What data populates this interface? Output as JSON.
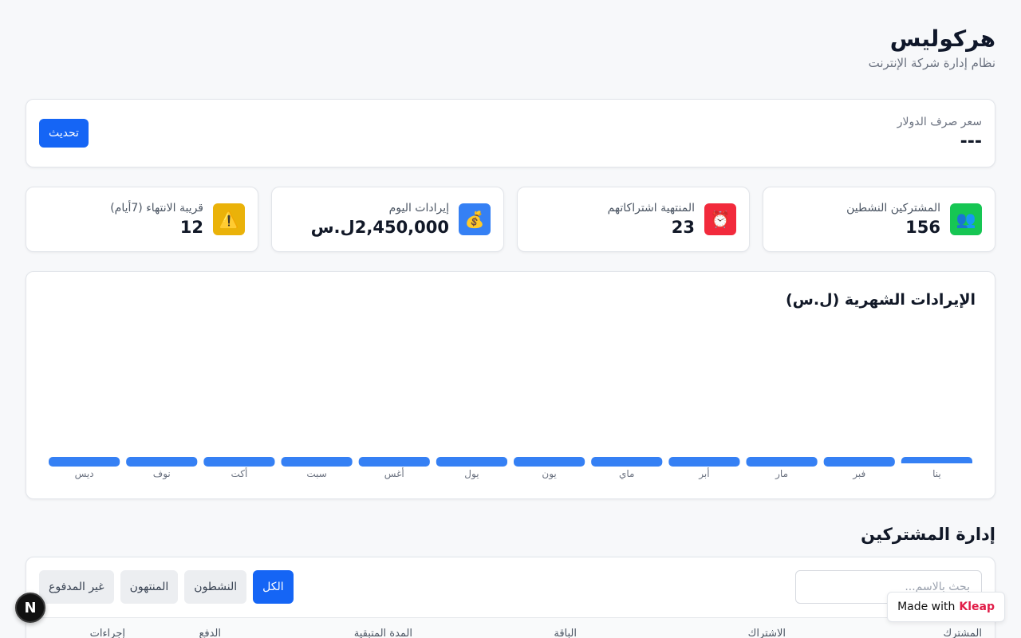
{
  "header": {
    "title": "هركوليس",
    "subtitle": "نظام إدارة شركة الإنترنت"
  },
  "exchange_rate": {
    "label": "سعر صرف الدولار",
    "value": "---",
    "refresh_label": "تحديث"
  },
  "stats": [
    {
      "label": "المشتركين النشطين",
      "value": "156",
      "icon": "users-icon",
      "color": "#16c653"
    },
    {
      "label": "المنتهية اشتراكاتهم",
      "value": "23",
      "icon": "alarm-clock-icon",
      "color": "#f22a3c"
    },
    {
      "label": "إيرادات اليوم",
      "value": "2,450,000ل.س",
      "icon": "money-bag-icon",
      "color": "#3580f4"
    },
    {
      "label": "قريبة الانتهاء (7أيام)",
      "value": "12",
      "icon": "warning-icon",
      "color": "#eab209"
    }
  ],
  "chart_data": {
    "type": "bar",
    "title": "الإيرادات الشهرية (ل.س)",
    "categories": [
      "ينا",
      "فبر",
      "مار",
      "أبر",
      "ماي",
      "يون",
      "يول",
      "أغس",
      "سبت",
      "أكت",
      "نوف",
      "ديس"
    ],
    "values": [
      0,
      0,
      0,
      0,
      0,
      0,
      0,
      0,
      0,
      0,
      0,
      0
    ],
    "color": "#3580f4",
    "xlabel": "",
    "ylabel": "",
    "grid": false
  },
  "subscribers": {
    "title": "إدارة المشتركين",
    "search_placeholder": "بحث بالاسم...",
    "filters": [
      "الكل",
      "النشطون",
      "المنتهون",
      "غير المدفوع"
    ],
    "active_filter": "الكل",
    "columns": [
      "المشترك",
      "الاشتراك",
      "الباقة",
      "المدة المتبقية",
      "الدفع",
      "إجراءات"
    ]
  },
  "fab_label": "N",
  "badge": {
    "made_with": "Made with",
    "brand": "Kleap"
  }
}
